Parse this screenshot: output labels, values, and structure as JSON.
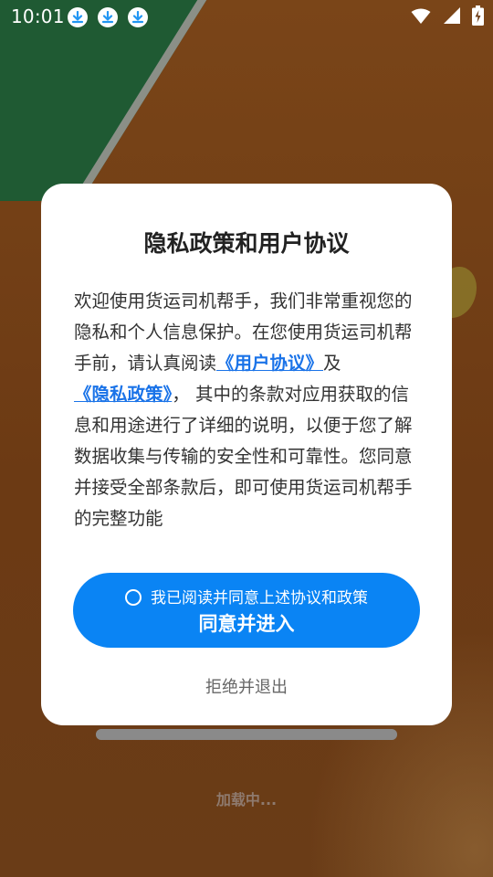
{
  "status_bar": {
    "time": "10:01",
    "notification_icons": [
      "download-icon",
      "download-icon",
      "download-icon"
    ],
    "system_icons": [
      "wifi-icon",
      "signal-icon",
      "battery-charging-icon"
    ]
  },
  "dialog": {
    "title": "隐私政策和用户协议",
    "body": {
      "part1": "欢迎使用货运司机帮手，我们非常重视您的隐私和个人信息保护。在您使用货运司机帮手前，请认真阅读",
      "user_agreement_link": "《用户协议》",
      "and": "及",
      "privacy_policy_link": "《隐私政策》",
      "part2": "， 其中的条款对应用获取的信息和用途进行了详细的说明，以便于您了解数据收集与传输的安全性和可靠性。您同意并接受全部条款后，即可使用货运司机帮手的完整功能"
    },
    "consent_checkbox_label": "我已阅读并同意上述协议和政策",
    "agree_button_label": "同意并进入",
    "reject_button_label": "拒绝并退出"
  },
  "loading": {
    "text": "加载中...",
    "progress": 1.0
  },
  "colors": {
    "primary_blue": "#0a84f4",
    "link_blue": "#1a73e8",
    "background_brown": "#6e3d17",
    "download_badge": "#2196f3"
  }
}
